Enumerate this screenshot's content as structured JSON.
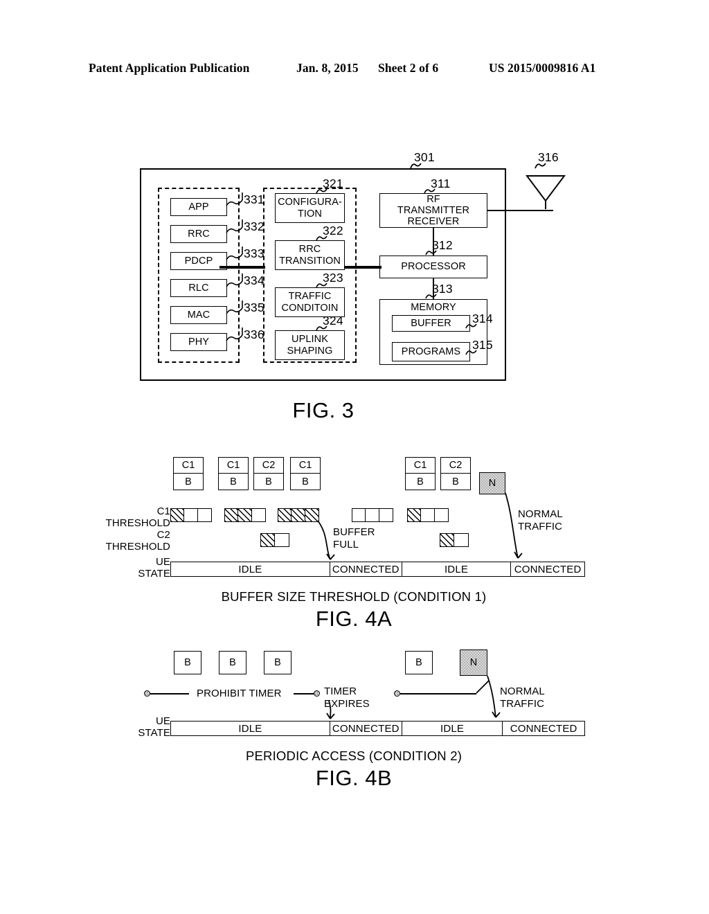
{
  "header": {
    "publication": "Patent Application Publication",
    "date": "Jan. 8, 2015",
    "sheet": "Sheet 2 of 6",
    "number": "US 2015/0009816 A1"
  },
  "fig3": {
    "label": "FIG. 3",
    "device_ref": "301",
    "antenna_ref": "316",
    "stack_blocks": [
      {
        "label": "APP",
        "ref": "331"
      },
      {
        "label": "RRC",
        "ref": "332"
      },
      {
        "label": "PDCP",
        "ref": "333"
      },
      {
        "label": "RLC",
        "ref": "334"
      },
      {
        "label": "MAC",
        "ref": "335"
      },
      {
        "label": "PHY",
        "ref": "336"
      }
    ],
    "function_blocks": [
      {
        "label": "CONFIGURA-\nTION",
        "ref": "321"
      },
      {
        "label": "RRC\nTRANSITION",
        "ref": "322"
      },
      {
        "label": "TRAFFIC\nCONDITOIN",
        "ref": "323"
      },
      {
        "label": "UPLINK\nSHAPING",
        "ref": "324"
      }
    ],
    "hardware_blocks": [
      {
        "label": "RF\nTRANSMITTER\nRECEIVER",
        "ref": "311"
      },
      {
        "label": "PROCESSOR",
        "ref": "312"
      },
      {
        "label": "MEMORY",
        "ref": "313"
      },
      {
        "label": "BUFFER",
        "ref": "314"
      },
      {
        "label": "PROGRAMS",
        "ref": "315"
      }
    ]
  },
  "fig4a": {
    "label": "FIG. 4A",
    "caption": "BUFFER SIZE THRESHOLD (CONDITION 1)",
    "packets": [
      {
        "class": "C1",
        "body": "B"
      },
      {
        "class": "C1",
        "body": "B"
      },
      {
        "class": "C2",
        "body": "B"
      },
      {
        "class": "C1",
        "body": "B"
      },
      {
        "class": "C1",
        "body": "B"
      },
      {
        "class": "C2",
        "body": "B"
      }
    ],
    "normal_packet": "N",
    "c1_threshold_label": "C1\nTHRESHOLD",
    "c2_threshold_label": "C2\nTHRESHOLD",
    "ue_state_label": "UE\nSTATE",
    "c1_meters": [
      {
        "cells": 3,
        "filled": 1
      },
      {
        "cells": 3,
        "filled": 2
      },
      {
        "cells": 3,
        "filled": 3
      },
      {
        "cells": 3,
        "filled": 0
      },
      {
        "cells": 3,
        "filled": 1
      }
    ],
    "c2_meters": [
      {
        "cells": 2,
        "filled": 1
      },
      {
        "cells": 2,
        "filled": 1
      }
    ],
    "annotations": [
      {
        "text": "BUFFER\nFULL"
      },
      {
        "text": "NORMAL\nTRAFFIC"
      }
    ],
    "ue_states": [
      "IDLE",
      "CONNECTED",
      "IDLE",
      "CONNECTED"
    ]
  },
  "fig4b": {
    "label": "FIG. 4B",
    "caption": "PERIODIC ACCESS (CONDITION 2)",
    "packets": [
      "B",
      "B",
      "B",
      "B"
    ],
    "normal_packet": "N",
    "prohibit_timer_label": "PROHIBIT TIMER",
    "timer_expires_label": "TIMER\nEXPIRES",
    "normal_traffic_label": "NORMAL\nTRAFFIC",
    "ue_state_label": "UE\nSTATE",
    "ue_states": [
      "IDLE",
      "CONNECTED",
      "IDLE",
      "CONNECTED"
    ]
  }
}
